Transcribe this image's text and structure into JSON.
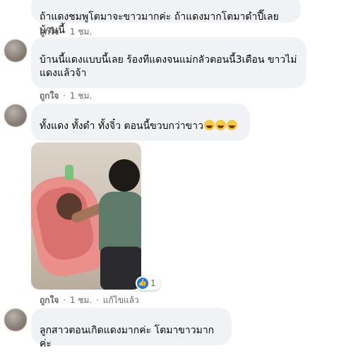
{
  "comments": [
    {
      "text": "ถ้าแดงชมพูโตมาจะขาวมากค่ะ ถ้าแดงมากโตมาดำปี๊เลยบ้านนี้",
      "actions": {
        "like": "ถูกใจ",
        "time": "1 ชม."
      }
    },
    {
      "text_lines": [
        "บ้านนี้แดงแบบนี้เลย ร้องทีแดงจนแม่กลัวตอนนี้3เดือน ขาวไม่",
        "แดงแล้วจ้า"
      ],
      "actions": {
        "like": "ถูกใจ",
        "time": "1 ชม."
      }
    },
    {
      "text": "ทั้งแดง ทั้งดำ ทั้งจิ๋ว ตอนนี้ขวบกว่าขาว",
      "emoji": [
        "laughing-emoji",
        "laughing-emoji",
        "laughing-emoji"
      ],
      "reaction": {
        "icon": "like-icon",
        "count": "1"
      },
      "actions": {
        "like": "ถูกใจ",
        "time": "1 ชม.",
        "edited": "แก้ไขแล้ว"
      }
    },
    {
      "text": "ลูกสาวตอนเกิดแดงมากค่ะ โตมาขาวมากค่ะ"
    }
  ],
  "separator": "·"
}
